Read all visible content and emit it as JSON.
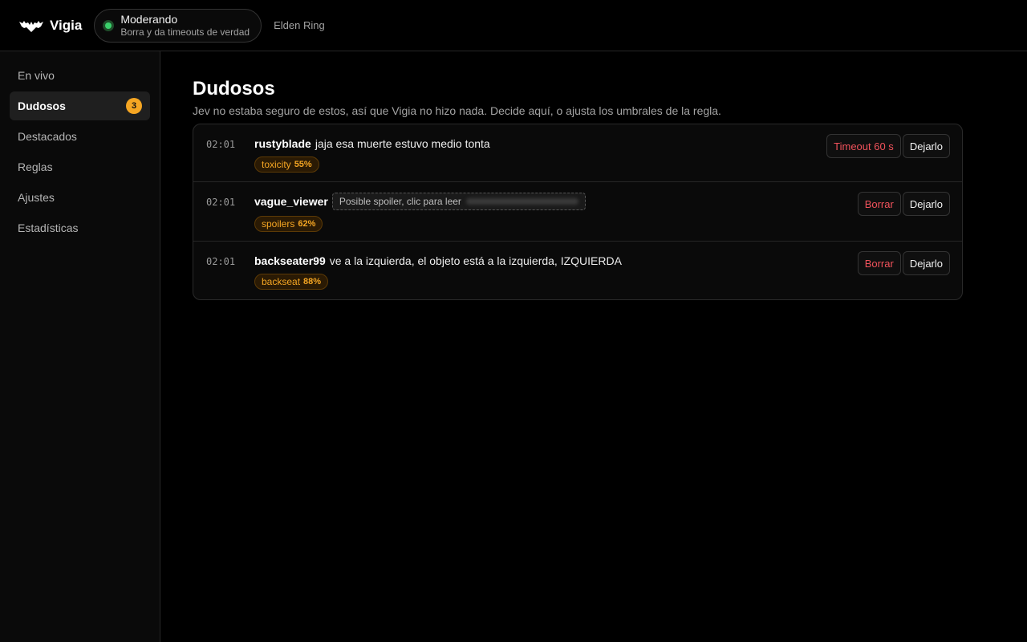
{
  "header": {
    "app_name": "Vigia",
    "logo_icon": "bat-icon",
    "status": {
      "title": "Moderando",
      "subtitle": "Borra y da timeouts de verdad",
      "color": "#3ad16b"
    },
    "game": "Elden Ring"
  },
  "sidebar": {
    "items": [
      {
        "label": "En vivo",
        "active": false
      },
      {
        "label": "Dudosos",
        "active": true,
        "badge": "3"
      },
      {
        "label": "Destacados",
        "active": false
      },
      {
        "label": "Reglas",
        "active": false
      },
      {
        "label": "Ajustes",
        "active": false
      },
      {
        "label": "Estadísticas",
        "active": false
      }
    ]
  },
  "main": {
    "title": "Dudosos",
    "description": "Jev no estaba seguro de estos, así que Vigia no hizo nada. Decide aquí, o ajusta los umbrales de la regla.",
    "messages": [
      {
        "time": "02:01",
        "user": "rustyblade",
        "text": "jaja esa muerte estuvo medio tonta",
        "tag": {
          "label": "toxicity",
          "score": "55%"
        },
        "actions": {
          "primary": "Timeout 60 s",
          "secondary": "Dejarlo"
        }
      },
      {
        "time": "02:01",
        "user": "vague_viewer",
        "spoiler_label": "Posible spoiler, clic para leer",
        "tag": {
          "label": "spoilers",
          "score": "62%"
        },
        "actions": {
          "primary": "Borrar",
          "secondary": "Dejarlo"
        }
      },
      {
        "time": "02:01",
        "user": "backseater99",
        "text": "ve a la izquierda, el objeto está a la izquierda, IZQUIERDA",
        "tag": {
          "label": "backseat",
          "score": "88%"
        },
        "actions": {
          "primary": "Borrar",
          "secondary": "Dejarlo"
        }
      }
    ]
  },
  "colors": {
    "accent": "#f5a623",
    "danger": "#f0525b",
    "background": "#000000",
    "panel": "#0a0a0a"
  }
}
